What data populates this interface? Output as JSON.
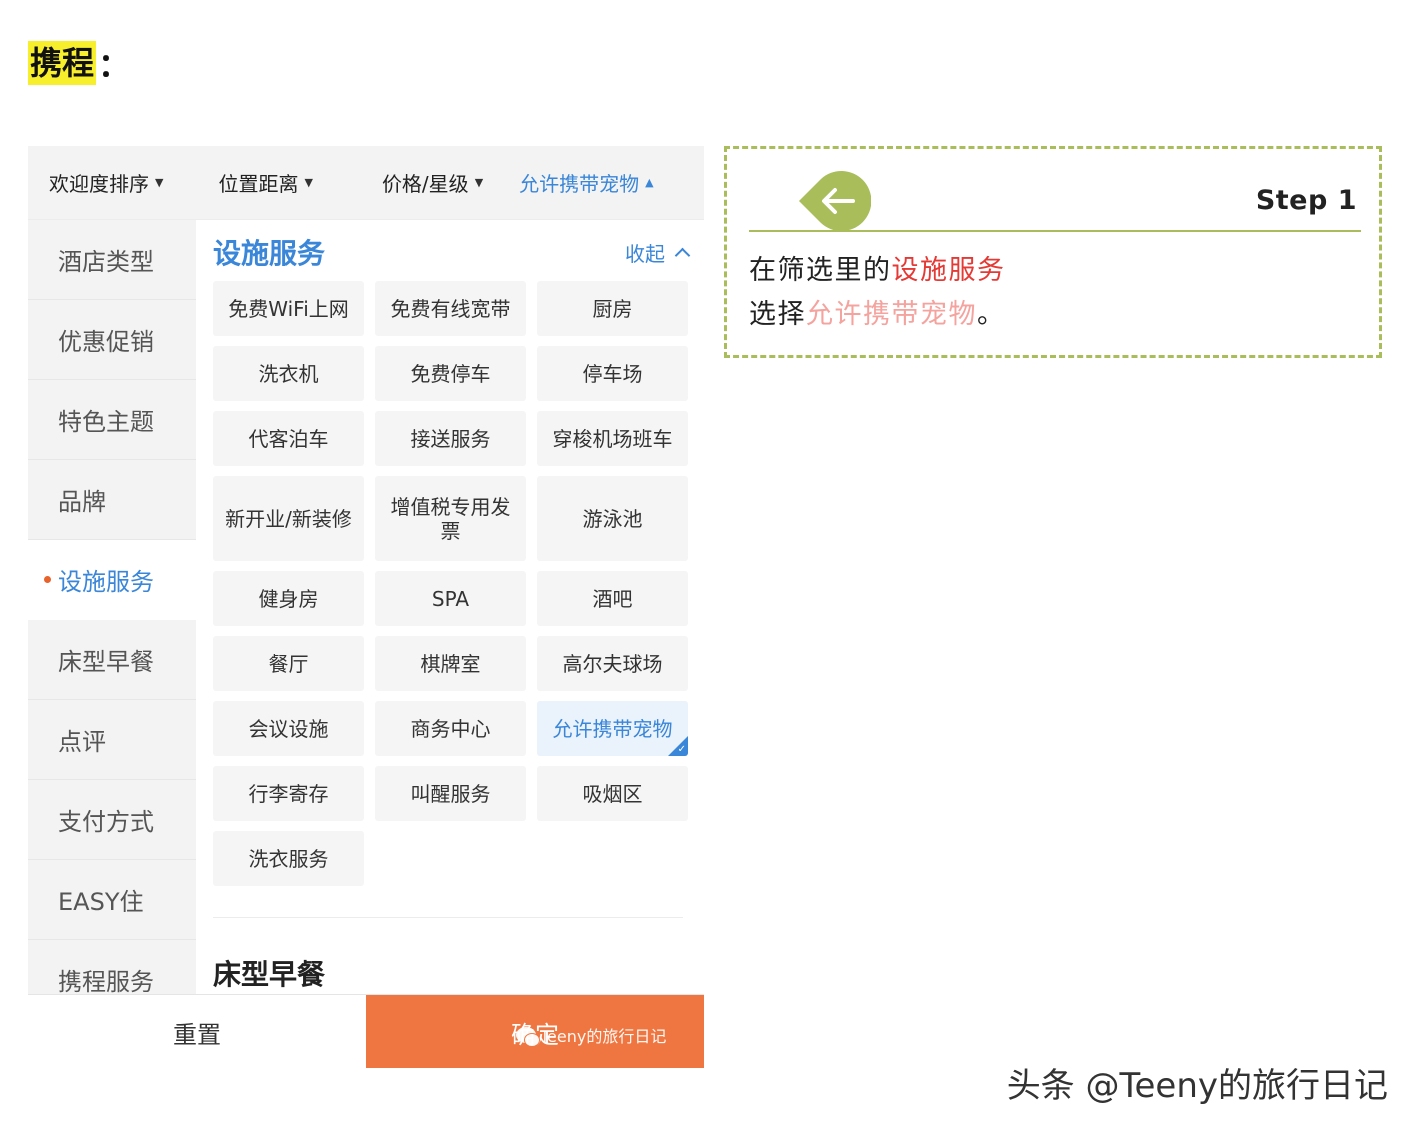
{
  "heading": {
    "highlight": "携程",
    "colon": "："
  },
  "sort_bar": [
    {
      "label": "欢迎度排序",
      "active": false
    },
    {
      "label": "位置距离",
      "active": false
    },
    {
      "label": "价格/星级",
      "active": false
    },
    {
      "label": "允许携带宠物",
      "active": true
    }
  ],
  "left_nav": [
    {
      "label": "酒店类型",
      "active": false
    },
    {
      "label": "优惠促销",
      "active": false
    },
    {
      "label": "特色主题",
      "active": false
    },
    {
      "label": "品牌",
      "active": false
    },
    {
      "label": "设施服务",
      "active": true
    },
    {
      "label": "床型早餐",
      "active": false
    },
    {
      "label": "点评",
      "active": false
    },
    {
      "label": "支付方式",
      "active": false
    },
    {
      "label": "EASY住",
      "active": false
    },
    {
      "label": "携程服务",
      "active": false
    }
  ],
  "content": {
    "section_title": "设施服务",
    "collapse_label": "收起",
    "facilities": [
      [
        "免费WiFi上网",
        "免费有线宽带",
        "厨房"
      ],
      [
        "洗衣机",
        "免费停车",
        "停车场"
      ],
      [
        "代客泊车",
        "接送服务",
        "穿梭机场班车"
      ],
      [
        "新开业/新装修",
        "增值税专用发票",
        "游泳池"
      ],
      [
        "健身房",
        "SPA",
        "酒吧"
      ],
      [
        "餐厅",
        "棋牌室",
        "高尔夫球场"
      ],
      [
        "会议设施",
        "商务中心",
        "允许携带宠物"
      ],
      [
        "行李寄存",
        "叫醒服务",
        "吸烟区"
      ],
      [
        "洗衣服务"
      ]
    ],
    "selected_facility": "允许携带宠物",
    "next_section_title": "床型早餐"
  },
  "bottom_bar": {
    "reset_label": "重置",
    "confirm_label": "确定",
    "watermark": "Teeny的旅行日记"
  },
  "callout": {
    "step_label": "Step 1",
    "line1_prefix": "在筛选里的",
    "line1_highlight": "设施服务",
    "line2_prefix": "选择",
    "line2_highlight": "允许携带宠物",
    "line2_suffix": "。",
    "accent_color": "#a9bd5b",
    "highlight_red": "#e53935",
    "highlight_pink": "#f4a39e"
  },
  "footer_watermark": "头条 @Teeny的旅行日记",
  "colors": {
    "brand_blue": "#3a86d8",
    "confirm_orange": "#ef7640",
    "heading_highlight": "#f7ef2b"
  }
}
